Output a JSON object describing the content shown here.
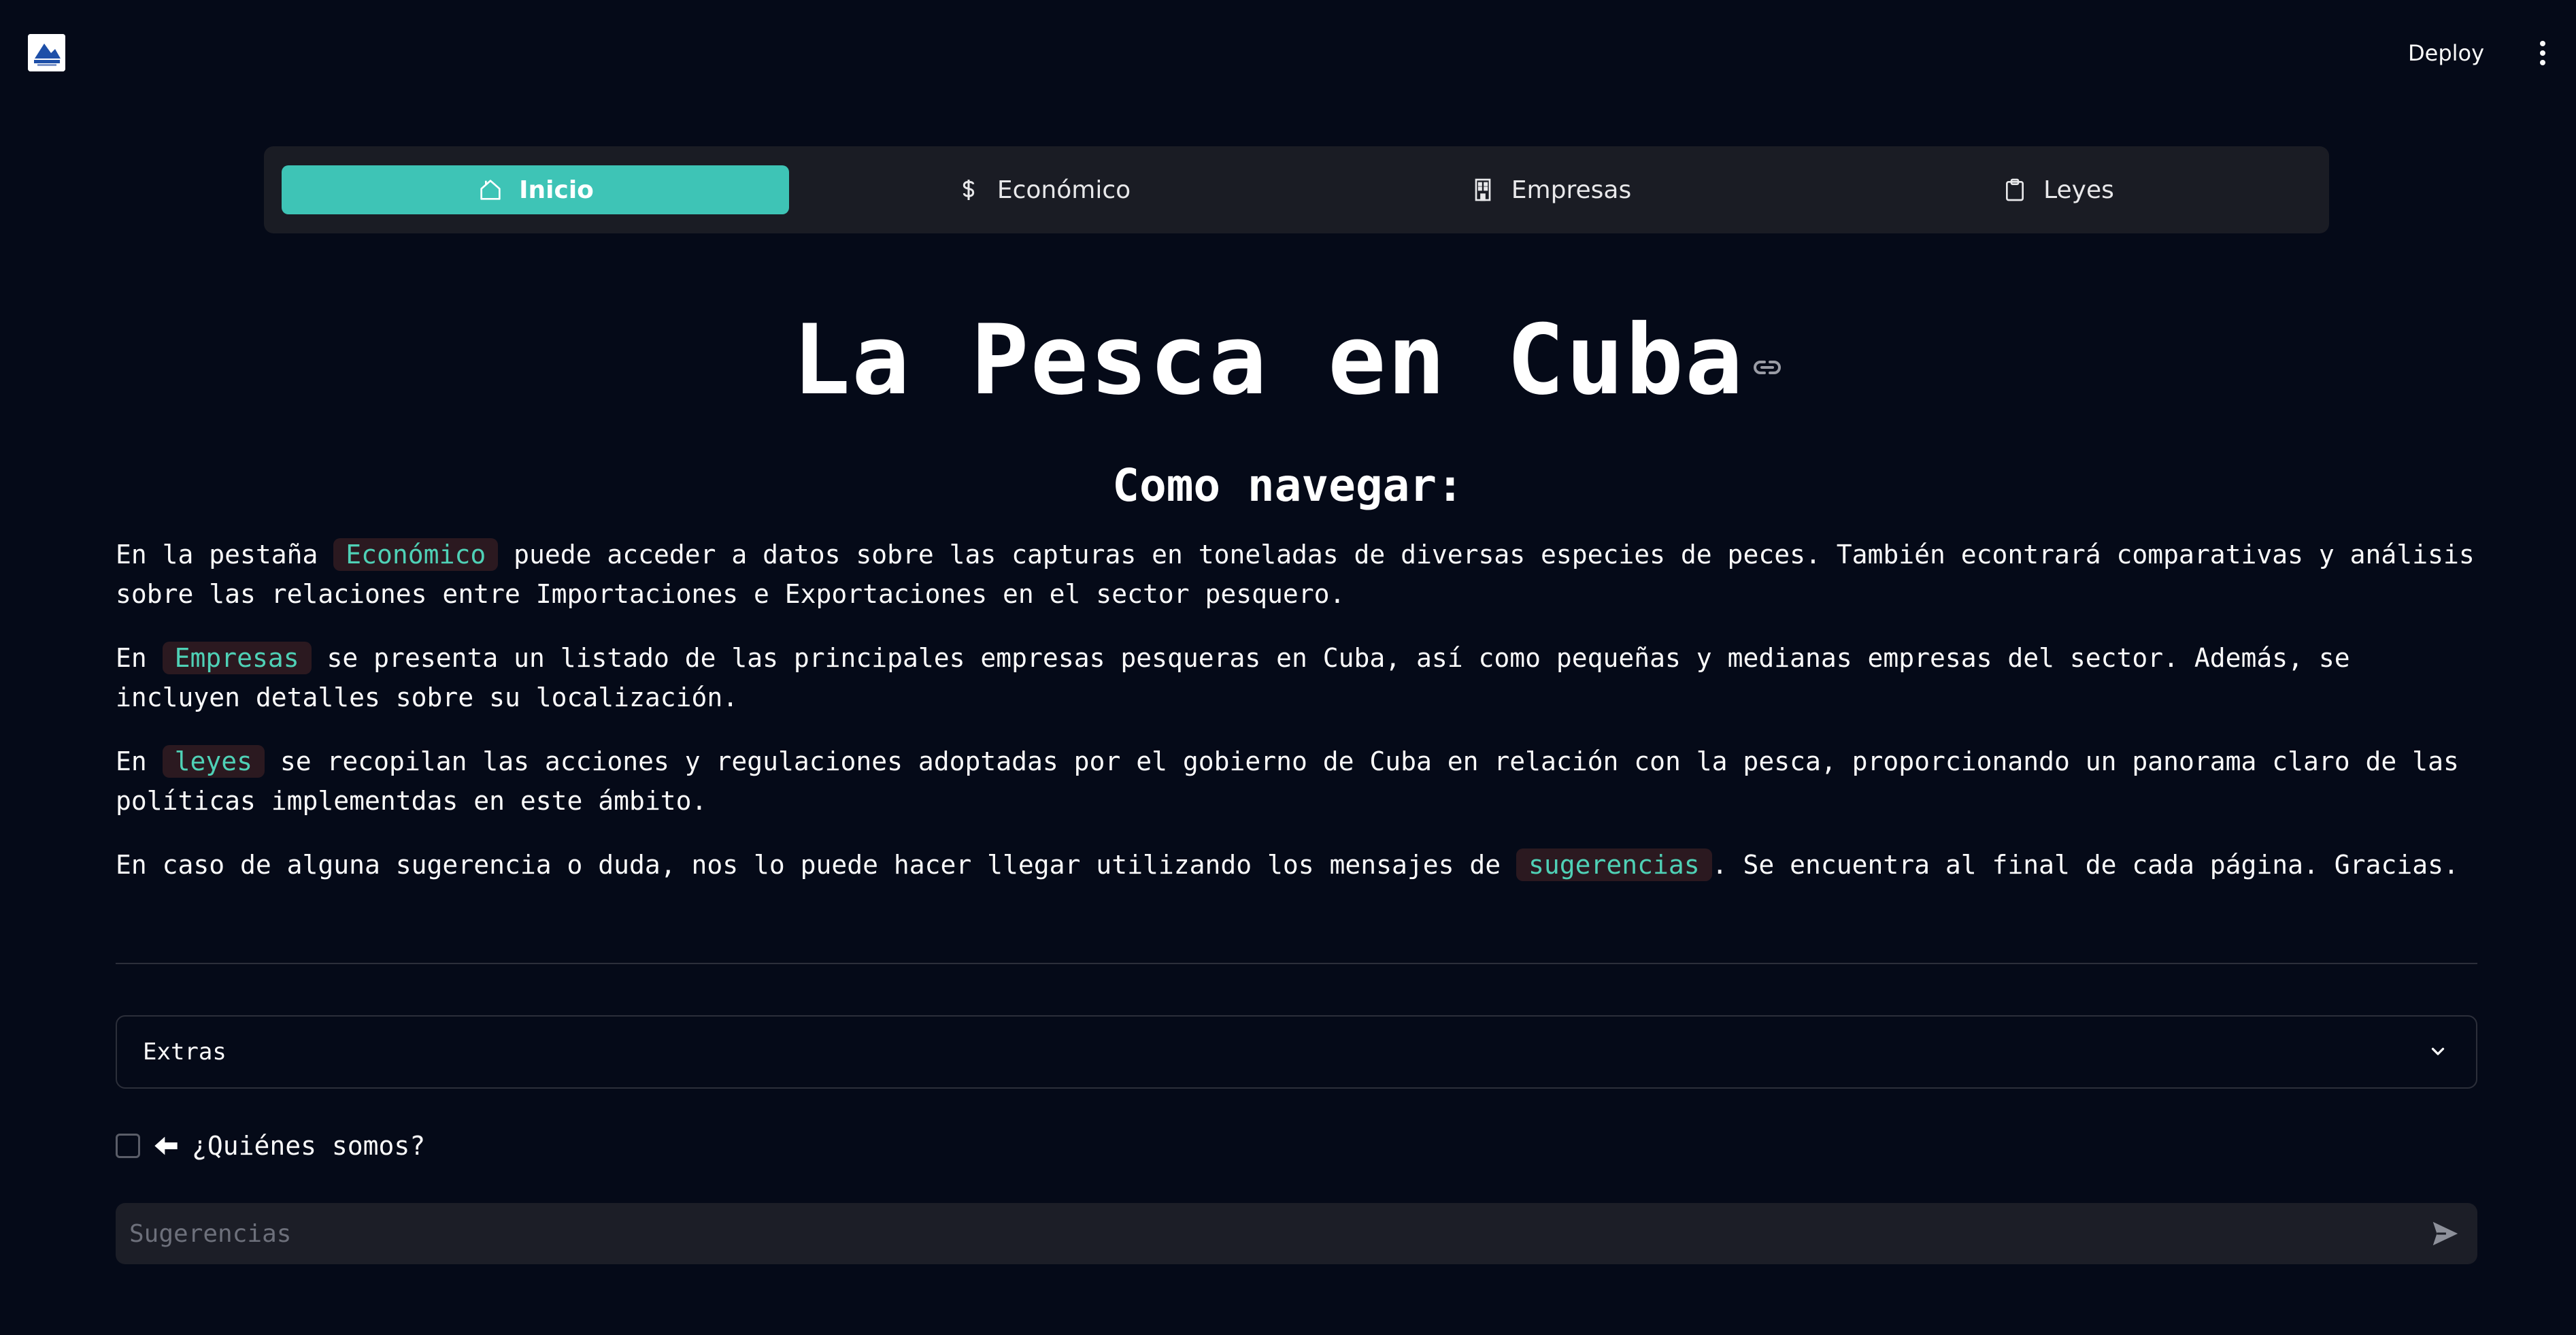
{
  "header": {
    "logo_icon": "company-logo",
    "deploy_label": "Deploy",
    "menu_icon": "kebab-menu-icon"
  },
  "tabs": [
    {
      "label": "Inicio",
      "icon": "home-icon",
      "active": true
    },
    {
      "label": "Económico",
      "icon": "dollar-icon",
      "active": false
    },
    {
      "label": "Empresas",
      "icon": "building-icon",
      "active": false
    },
    {
      "label": "Leyes",
      "icon": "clipboard-icon",
      "active": false
    }
  ],
  "main": {
    "title": "La Pesca en Cuba",
    "subtitle": "Como navegar:",
    "paragraphs": [
      {
        "before": "En la pestaña ",
        "code": "Económico",
        "after": " puede acceder a datos sobre las capturas en toneladas de diversas especies de peces. También econtrará comparativas y análisis sobre las relaciones entre Importaciones e Exportaciones en el sector pesquero."
      },
      {
        "before": "En ",
        "code": "Empresas",
        "after": " se presenta un listado de las principales empresas pesqueras en Cuba, así como pequeñas y medianas empresas del sector. Además, se incluyen detalles sobre su localización."
      },
      {
        "before": "En ",
        "code": "leyes",
        "after": " se recopilan las acciones y regulaciones adoptadas por el gobierno de Cuba en relación con la pesca, proporcionando un panorama claro de las políticas implementdas en este ámbito."
      },
      {
        "before": "En caso de alguna sugerencia o duda, nos lo puede hacer llegar utilizando los mensajes de ",
        "code": "sugerencias",
        "after": ". Se encuentra al final de cada página. Gracias."
      }
    ]
  },
  "expander": {
    "label": "Extras"
  },
  "checkbox": {
    "label": "¿Quiénes somos?",
    "checked": false
  },
  "chat": {
    "placeholder": "Sugerencias"
  },
  "colors": {
    "background": "#050a18",
    "accent": "#3ec4b6",
    "code_text": "#4fd1b6",
    "code_bg": "#2b1920",
    "panel": "#1a1c24"
  }
}
